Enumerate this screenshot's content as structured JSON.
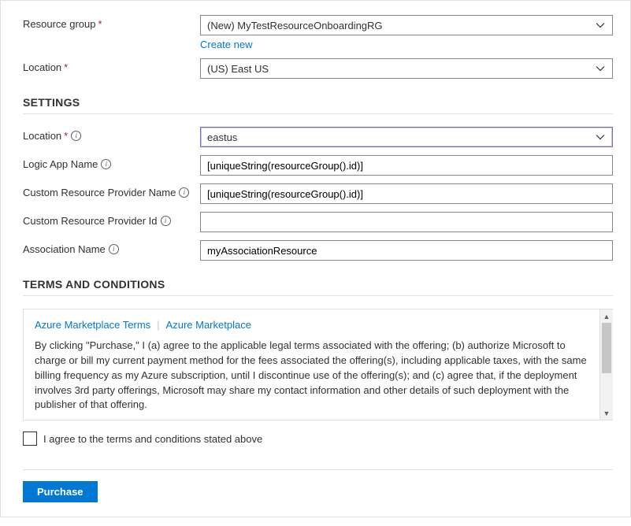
{
  "basics": {
    "resource_group_label": "Resource group",
    "resource_group_value": "(New) MyTestResourceOnboardingRG",
    "create_new_link": "Create new",
    "location_label": "Location",
    "location_value": "(US) East US"
  },
  "settings": {
    "heading": "SETTINGS",
    "location_label": "Location",
    "location_value": "eastus",
    "logic_app_label": "Logic App Name",
    "logic_app_value": "[uniqueString(resourceGroup().id)]",
    "crp_name_label": "Custom Resource Provider Name",
    "crp_name_value": "[uniqueString(resourceGroup().id)]",
    "crp_id_label": "Custom Resource Provider Id",
    "crp_id_value": "",
    "assoc_name_label": "Association Name",
    "assoc_name_value": "myAssociationResource"
  },
  "terms": {
    "heading": "TERMS AND CONDITIONS",
    "link1": "Azure Marketplace Terms",
    "link2": "Azure Marketplace",
    "body": "By clicking \"Purchase,\" I (a) agree to the applicable legal terms associated with the offering; (b) authorize Microsoft to charge or bill my current payment method for the fees associated the offering(s), including applicable taxes, with the same billing frequency as my Azure subscription, until I discontinue use of the offering(s); and (c) agree that, if the deployment involves 3rd party offerings, Microsoft may share my contact information and other details of such deployment with the publisher of that offering.",
    "agree_label": "I agree to the terms and conditions stated above"
  },
  "footer": {
    "purchase_label": "Purchase"
  }
}
